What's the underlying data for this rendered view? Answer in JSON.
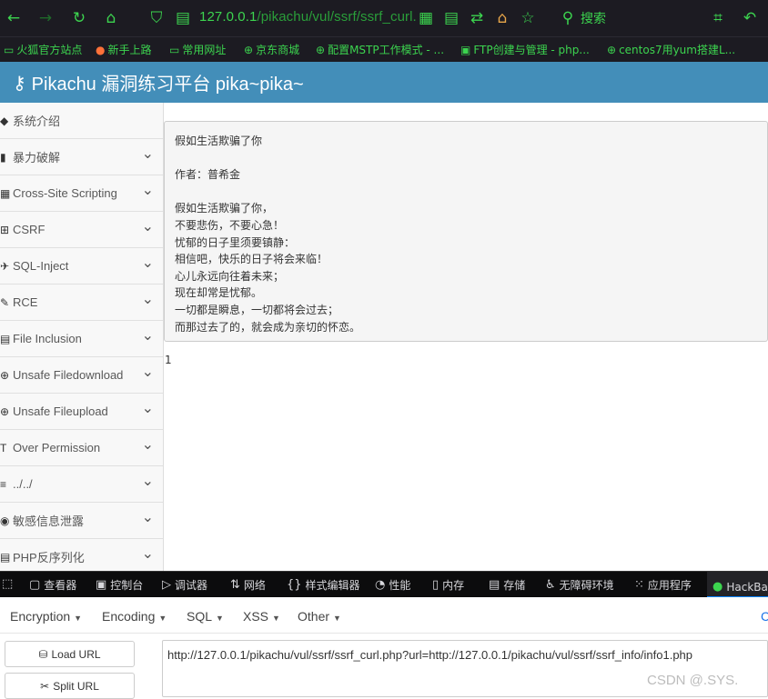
{
  "browser": {
    "url_host": "127.0.0.1",
    "url_path": "/pikachu/vul/ssrf/ssrf_curl.",
    "search_label": "搜索",
    "bookmarks": [
      "火狐官方站点",
      "新手上路",
      "常用网址",
      "京东商城",
      "配置MSTP工作模式 - ...",
      "FTP创建与管理 - php...",
      "centos7用yum搭建L..."
    ]
  },
  "header": {
    "title": "Pikachu 漏洞练习平台 pika~pika~"
  },
  "sidebar": {
    "items": [
      {
        "label": "系统介绍",
        "icon": "◆",
        "chevron": false
      },
      {
        "label": "暴力破解",
        "icon": "▮",
        "chevron": true
      },
      {
        "label": "Cross-Site Scripting",
        "icon": "▦",
        "chevron": true
      },
      {
        "label": "CSRF",
        "icon": "⊞",
        "chevron": true
      },
      {
        "label": "SQL-Inject",
        "icon": "✈",
        "chevron": true
      },
      {
        "label": "RCE",
        "icon": "✎",
        "chevron": true
      },
      {
        "label": "File Inclusion",
        "icon": "▤",
        "chevron": true
      },
      {
        "label": "Unsafe Filedownload",
        "icon": "⊕",
        "chevron": true
      },
      {
        "label": "Unsafe Fileupload",
        "icon": "⊕",
        "chevron": true
      },
      {
        "label": "Over Permission",
        "icon": "T",
        "chevron": true
      },
      {
        "label": "../../",
        "icon": "≡",
        "chevron": true
      },
      {
        "label": "敏感信息泄露",
        "icon": "◉",
        "chevron": true
      },
      {
        "label": "PHP反序列化",
        "icon": "▤",
        "chevron": true
      }
    ]
  },
  "content": {
    "poem_lines": [
      "假如生活欺骗了你",
      "",
      "作者：普希金",
      "",
      "假如生活欺骗了你，",
      "不要悲伤，不要心急！",
      "忧郁的日子里须要镇静：",
      "相信吧，快乐的日子将会来临！",
      "心儿永远向往着未来；",
      "现在却常是忧郁。",
      "一切都是瞬息，一切都将会过去；",
      "而那过去了的，就会成为亲切的怀恋。"
    ],
    "result": "1"
  },
  "devtools": {
    "tabs": [
      "查看器",
      "控制台",
      "调试器",
      "网络",
      "样式编辑器",
      "性能",
      "内存",
      "存储",
      "无障碍环境",
      "应用程序",
      "HackBar"
    ]
  },
  "hackbar": {
    "menus": [
      "Encryption",
      "Encoding",
      "SQL",
      "XSS",
      "Other"
    ],
    "load_url": "Load URL",
    "split_url": "Split URL",
    "url_value": "http://127.0.0.1/pikachu/vul/ssrf/ssrf_curl.php?url=http://127.0.0.1/pikachu/vul/ssrf/ssrf_info/info1.php"
  },
  "watermark": "CSDN @.SYS."
}
